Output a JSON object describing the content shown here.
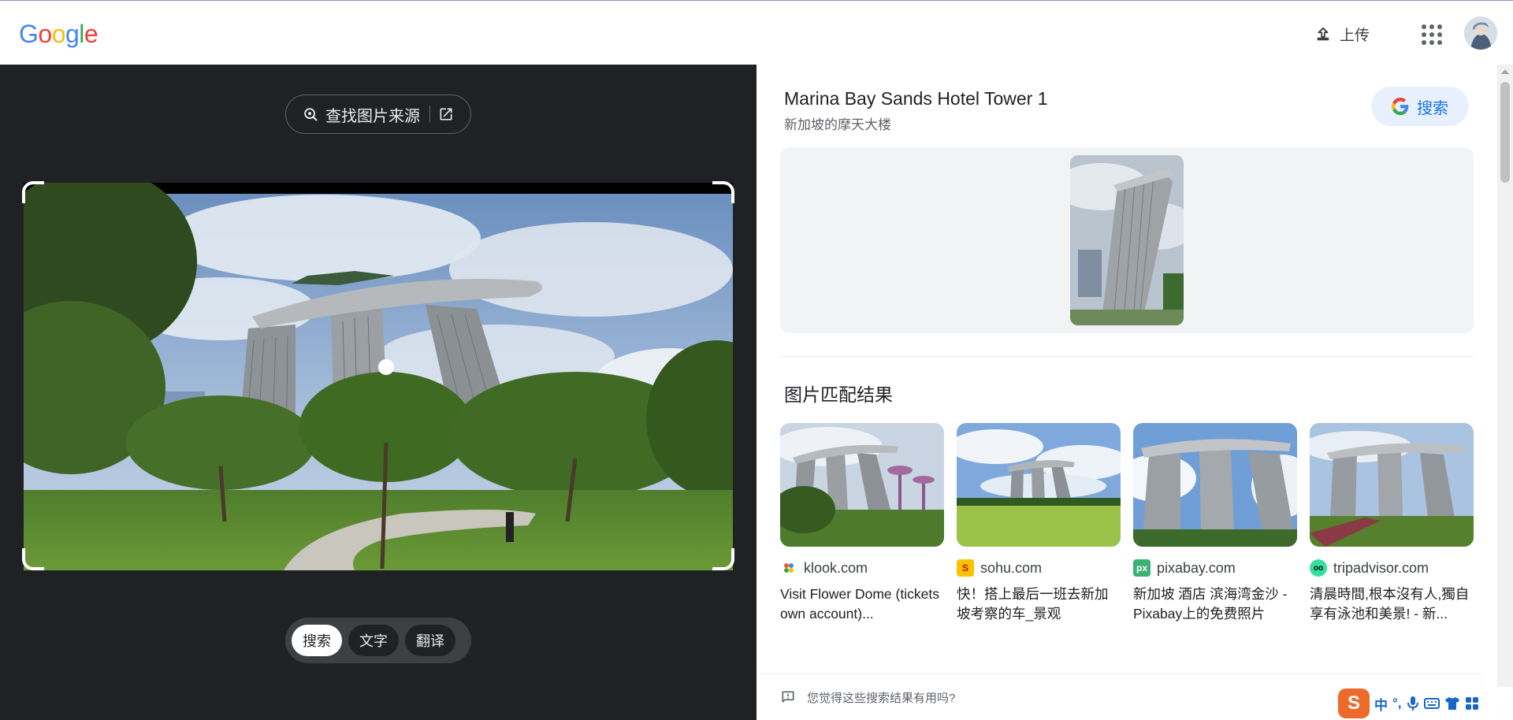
{
  "header": {
    "logo_letters": [
      {
        "ch": "G",
        "color": "#4285F4"
      },
      {
        "ch": "o",
        "color": "#EA4335"
      },
      {
        "ch": "o",
        "color": "#FBBC05"
      },
      {
        "ch": "g",
        "color": "#4285F4"
      },
      {
        "ch": "l",
        "color": "#34A853"
      },
      {
        "ch": "e",
        "color": "#EA4335"
      }
    ],
    "upload_label": "上传",
    "apps_icon": "apps-grid-icon",
    "avatar": "user-avatar"
  },
  "left": {
    "find_source_label": "查找图片来源",
    "modes": [
      {
        "label": "搜索",
        "active": true
      },
      {
        "label": "文字",
        "active": false
      },
      {
        "label": "翻译",
        "active": false
      }
    ]
  },
  "entity": {
    "title": "Marina Bay Sands Hotel Tower 1",
    "subtitle": "新加坡的摩天大楼",
    "search_label": "搜索"
  },
  "matches": {
    "section_title": "图片匹配结果",
    "items": [
      {
        "site": "klook.com",
        "title": "Visit Flower Dome (tickets own account)...",
        "fav_color": "#ff5b00",
        "fav_char": "•"
      },
      {
        "site": "sohu.com",
        "title": "快！搭上最后一班去新加坡考察的车_景观",
        "fav_color": "#f8c300",
        "fav_char": "S"
      },
      {
        "site": "pixabay.com",
        "title": "新加坡 酒店 滨海湾金沙 - Pixabay上的免费照片",
        "fav_color": "#3bb273",
        "fav_char": "px"
      },
      {
        "site": "tripadvisor.com",
        "title": "清晨時間,根本沒有人,獨自享有泳池和美景! - 新...",
        "fav_color": "#34e0a1",
        "fav_char": "oo"
      }
    ]
  },
  "feedback": {
    "text": "您觉得这些搜索结果有用吗?"
  },
  "ime": {
    "logo": "S",
    "lang": "中",
    "punct": "°,"
  },
  "colors": {
    "accent": "#1a73e8",
    "dark_pane": "#202124",
    "pill_bg": "#e8f0fe"
  }
}
